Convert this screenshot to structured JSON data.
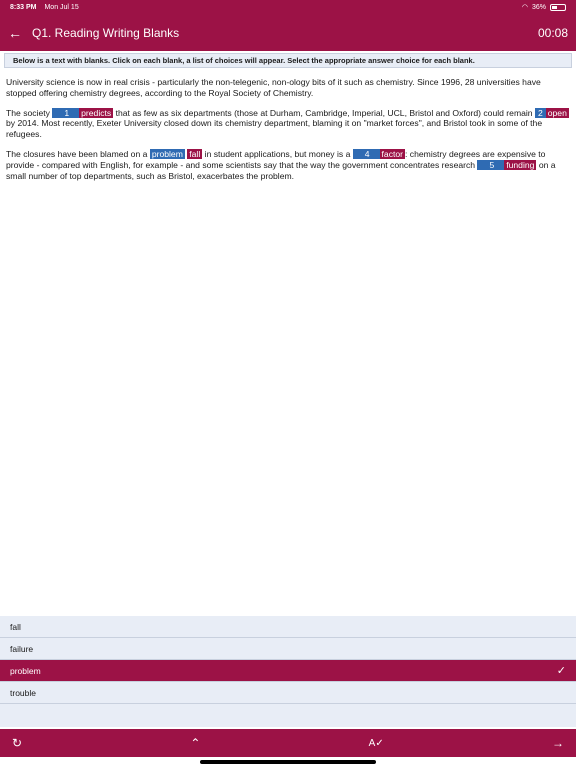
{
  "status": {
    "time": "8:33 PM",
    "date": "Mon Jul 15",
    "battery": "36%"
  },
  "header": {
    "back_icon": "arrow-left-icon",
    "title": "Q1. Reading Writing Blanks",
    "timer": "00:08"
  },
  "instruction": "Below is a text with blanks. Click on each blank, a list of choices will appear. Select the appropriate answer choice for each blank.",
  "passage": {
    "p1": "University science is now in real crisis - particularly the non-telegenic, non-ology bits of it such as chemistry. Since 1996, 28 universities have stopped offering chemistry degrees, according to the Royal Society of Chemistry.",
    "p2_a": "The society ",
    "b1_num": "1",
    "b1_ans": "predicts",
    "p2_b": " that as few as six departments (those at Durham, Cambridge, Imperial, UCL, Bristol and Oxford) could remain ",
    "b2_num": "2",
    "b2_ans": "open",
    "p2_c": " by 2014. Most recently, Exeter University closed down its chemistry department, blaming it on \"market forces\", and Bristol took in some of the refugees.",
    "p3_a": "The closures have been blamed on a ",
    "b3_ans1": "problem",
    "b3_ans2": "fall",
    "p3_b": " in student applications, but money is a ",
    "b4_num": "4",
    "b4_ans": "factor",
    "p3_c": ": chemistry degrees are expensive to provide - compared with English, for example - and some scientists say that the way the government concentrates research ",
    "b5_num": "5",
    "b5_ans": "funding",
    "p3_d": " on a small number of top departments, such as Bristol, exacerbates the problem."
  },
  "choices": [
    {
      "label": "fall",
      "selected": false
    },
    {
      "label": "failure",
      "selected": false
    },
    {
      "label": "problem",
      "selected": true
    },
    {
      "label": "trouble",
      "selected": false
    }
  ],
  "bottom_bar": {
    "icons": [
      "refresh-icon",
      "chevron-up-icon",
      "spell-check-icon",
      "arrow-right-icon"
    ]
  },
  "colors": {
    "primary": "#9c1246",
    "blank_blue": "#2f6bb3",
    "choice_bg": "#e8edf6"
  }
}
